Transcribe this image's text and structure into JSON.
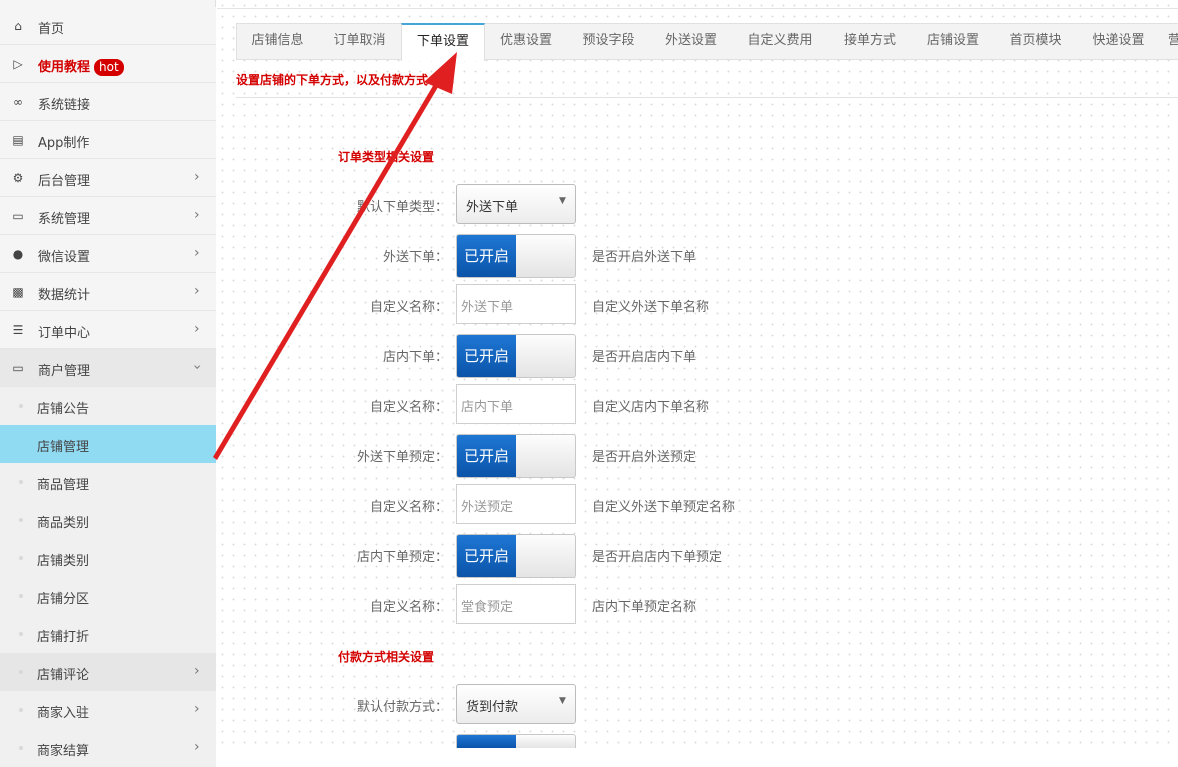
{
  "sidebar": {
    "items": [
      {
        "label": "首页",
        "icon": "home-icon"
      },
      {
        "label": "使用教程",
        "badge": "hot",
        "icon": "play-circle-icon"
      },
      {
        "label": "系统链接",
        "icon": "link-icon"
      },
      {
        "label": "App制作",
        "icon": "app-icon"
      },
      {
        "label": "后台管理",
        "icon": "gears-icon"
      },
      {
        "label": "系统管理",
        "icon": "monitor-icon"
      },
      {
        "label": "微信设置",
        "icon": "chat-icon"
      },
      {
        "label": "数据统计",
        "icon": "bar-chart-icon"
      },
      {
        "label": "订单中心",
        "icon": "list-icon"
      },
      {
        "label": "商户管理",
        "icon": "laptop-icon"
      }
    ],
    "subitems": [
      {
        "label": "店铺公告"
      },
      {
        "label": "店铺管理"
      },
      {
        "label": "商品管理"
      },
      {
        "label": "商品类别"
      },
      {
        "label": "店铺类别"
      },
      {
        "label": "店铺分区"
      },
      {
        "label": "店铺打折"
      },
      {
        "label": "店铺评论"
      },
      {
        "label": "商家入驻"
      },
      {
        "label": "商家结算"
      }
    ]
  },
  "tabs": [
    "店铺信息",
    "订单取消",
    "下单设置",
    "优惠设置",
    "预设字段",
    "外送设置",
    "自定义费用",
    "接单方式",
    "店铺设置",
    "首页模块",
    "快递设置",
    "营"
  ],
  "description": "设置店铺的下单方式，以及付款方式",
  "sections": {
    "order_type": "订单类型相关设置",
    "payment": "付款方式相关设置"
  },
  "form": {
    "default_order_type": {
      "label": "默认下单类型：",
      "value": "外送下单"
    },
    "delivery_order": {
      "label": "外送下单：",
      "toggle": "已开启",
      "help": "是否开启外送下单"
    },
    "delivery_name": {
      "label": "自定义名称：",
      "placeholder": "外送下单",
      "help": "自定义外送下单名称"
    },
    "dinein_order": {
      "label": "店内下单：",
      "toggle": "已开启",
      "help": "是否开启店内下单"
    },
    "dinein_name": {
      "label": "自定义名称：",
      "placeholder": "店内下单",
      "help": "自定义店内下单名称"
    },
    "delivery_preorder": {
      "label": "外送下单预定：",
      "toggle": "已开启",
      "help": "是否开启外送预定"
    },
    "delivery_preorder_name": {
      "label": "自定义名称：",
      "placeholder": "外送预定",
      "help": "自定义外送下单预定名称"
    },
    "dinein_preorder": {
      "label": "店内下单预定：",
      "toggle": "已开启",
      "help": "是否开启店内下单预定"
    },
    "dinein_preorder_name": {
      "label": "自定义名称：",
      "placeholder": "堂食预定",
      "help": "店内下单预定名称"
    },
    "default_payment": {
      "label": "默认付款方式：",
      "value": "货到付款"
    }
  },
  "colors": {
    "accent": "#d40000",
    "toggle_on": "#0a52a8",
    "active_menu": "#90daf2",
    "arrow": "#e02020"
  }
}
